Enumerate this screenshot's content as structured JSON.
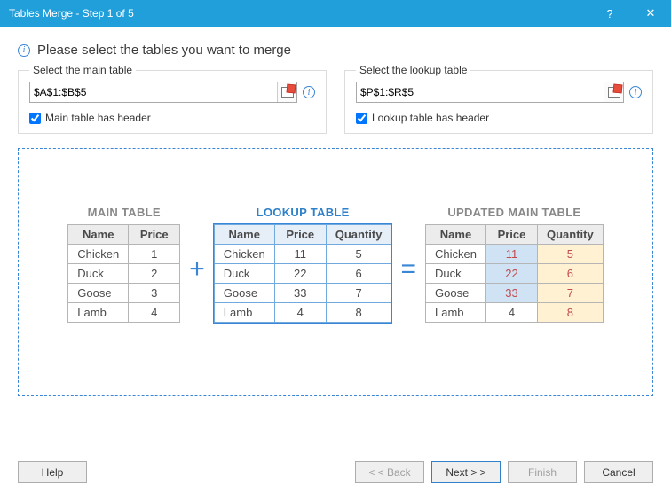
{
  "titlebar": {
    "title": "Tables Merge - Step 1 of 5",
    "help": "?",
    "close": "✕"
  },
  "instruction": "Please select the tables you want to merge",
  "main_picker": {
    "legend": "Select the main table",
    "value": "$A$1:$B$5",
    "header_label": "Main table has header"
  },
  "lookup_picker": {
    "legend": "Select the lookup table",
    "value": "$P$1:$R$5",
    "header_label": "Lookup table has header"
  },
  "preview": {
    "main_title": "MAIN TABLE",
    "lookup_title": "LOOKUP TABLE",
    "updated_title": "UPDATED MAIN TABLE",
    "plus": "+",
    "equals": "=",
    "headers": {
      "name": "Name",
      "price": "Price",
      "quantity": "Quantity"
    },
    "main": [
      {
        "name": "Chicken",
        "price": "1"
      },
      {
        "name": "Duck",
        "price": "2"
      },
      {
        "name": "Goose",
        "price": "3"
      },
      {
        "name": "Lamb",
        "price": "4"
      }
    ],
    "lookup": [
      {
        "name": "Chicken",
        "price": "11",
        "quantity": "5"
      },
      {
        "name": "Duck",
        "price": "22",
        "quantity": "6"
      },
      {
        "name": "Goose",
        "price": "33",
        "quantity": "7"
      },
      {
        "name": "Lamb",
        "price": "4",
        "quantity": "8"
      }
    ],
    "updated": [
      {
        "name": "Chicken",
        "price": "11",
        "quantity": "5",
        "price_hl": true,
        "qty_hl": true
      },
      {
        "name": "Duck",
        "price": "22",
        "quantity": "6",
        "price_hl": true,
        "qty_hl": true
      },
      {
        "name": "Goose",
        "price": "33",
        "quantity": "7",
        "price_hl": true,
        "qty_hl": true
      },
      {
        "name": "Lamb",
        "price": "4",
        "quantity": "8",
        "price_hl": false,
        "qty_hl": true
      }
    ]
  },
  "buttons": {
    "help": "Help",
    "back": "< < Back",
    "next": "Next > >",
    "finish": "Finish",
    "cancel": "Cancel"
  }
}
